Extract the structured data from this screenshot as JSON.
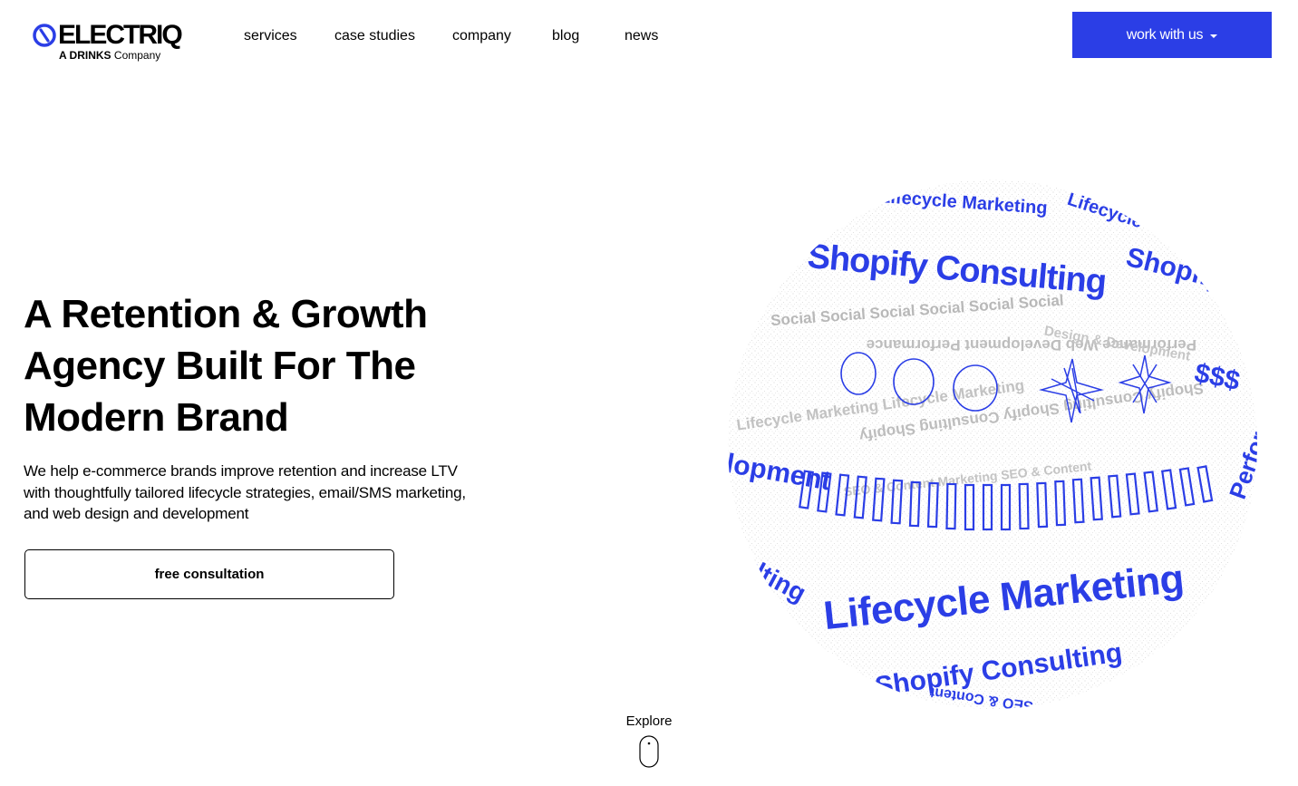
{
  "header": {
    "logo": {
      "wordmark": "ELECTRIQ",
      "sub_bold": "A DRINKS",
      "sub_rest": " Company"
    },
    "nav": [
      {
        "label": "services"
      },
      {
        "label": "case studies"
      },
      {
        "label": "company"
      },
      {
        "label": "blog"
      },
      {
        "label": "news"
      }
    ],
    "cta_label": "work with us"
  },
  "hero": {
    "title": "A Retention & Growth Agency Built For The Modern Brand",
    "description": "We help e-commerce brands improve retention and increase LTV with thoughtfully tailored lifecycle strategies, email/SMS marketing, and web design and development",
    "cta_label": "free consultation"
  },
  "sphere": {
    "text_big_1": "Shopify Consulting",
    "text_big_2": "Lifecycle Marketing",
    "text_top": "Lifecycle Marketing",
    "text_top_right": "Lifecycle",
    "text_shopify_right": "Shopify",
    "text_bottom": "Shopify Consulting",
    "text_bottom_2": "SEO & Content",
    "text_left_1": "Development",
    "text_left_2": "Consulting",
    "text_right_1": "Performance",
    "text_dollar": "$$$",
    "ghost_1": "Social   Social   Social   Social   Social   Social",
    "ghost_2": "Performance   Web Development   Performance",
    "ghost_3": "Lifecycle Marketing   Lifecycle Marketing",
    "ghost_4": "Shopify Consulting   Shopify Consulting   Shopify",
    "ghost_5": "SEO & Content Marketing   SEO & Content",
    "ghost_6": "Design & Development",
    "accent_color": "#2b3ee6"
  },
  "explore": {
    "label": "Explore"
  }
}
